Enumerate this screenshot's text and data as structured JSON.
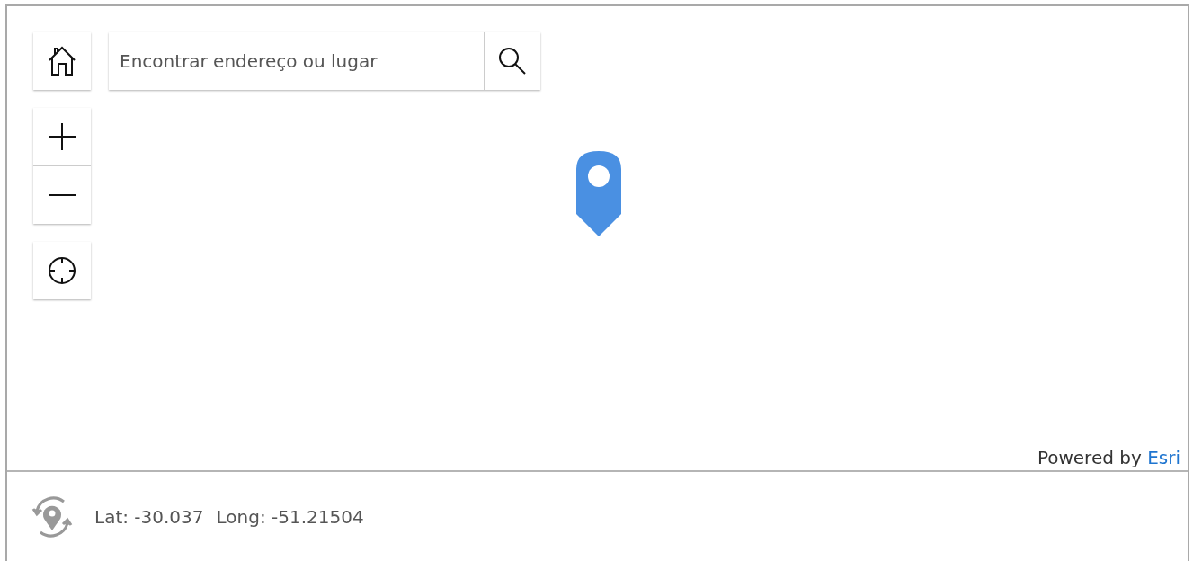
{
  "map": {
    "search": {
      "placeholder": "Encontrar endereço ou lugar"
    },
    "attribution": {
      "text": "Powered by",
      "link": "Esri"
    }
  },
  "footer": {
    "latitude": "Lat: -30.037",
    "longitude": "Long: -51.21504"
  }
}
